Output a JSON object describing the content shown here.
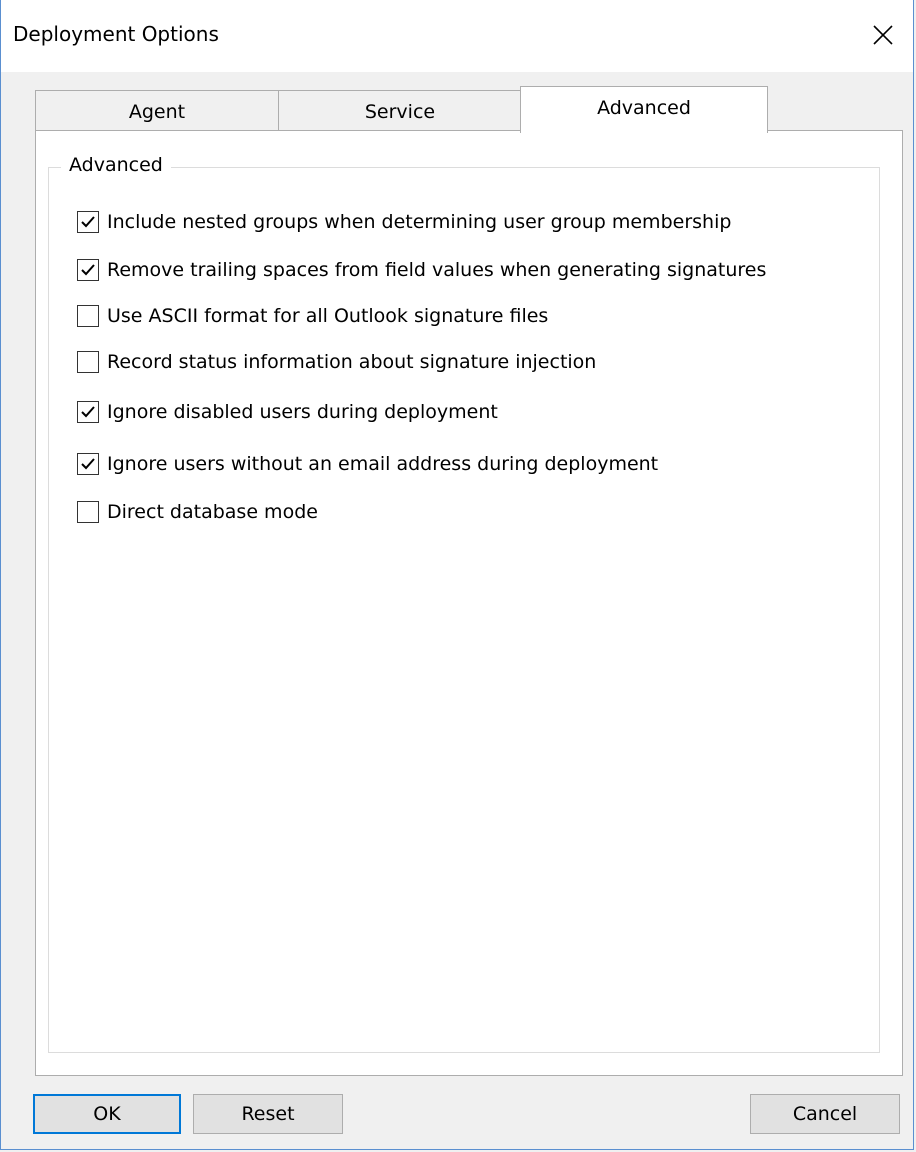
{
  "window": {
    "title": "Deployment Options",
    "close_glyph": "close-icon"
  },
  "tabs": [
    {
      "label": "Agent",
      "selected": false
    },
    {
      "label": "Service",
      "selected": false
    },
    {
      "label": "Advanced",
      "selected": true
    }
  ],
  "group": {
    "legend": "Advanced",
    "options": [
      {
        "label": "Include nested groups when determining user group membership",
        "checked": true
      },
      {
        "label": "Remove trailing spaces from field values when generating signatures",
        "checked": true
      },
      {
        "label": "Use ASCII format for all Outlook signature files",
        "checked": false
      },
      {
        "label": "Record status information about signature injection",
        "checked": false
      },
      {
        "label": "Ignore disabled users during deployment",
        "checked": true
      },
      {
        "label": "Ignore users without an email address during deployment",
        "checked": true
      },
      {
        "label": "Direct database mode",
        "checked": false
      }
    ]
  },
  "buttons": {
    "ok": "OK",
    "reset": "Reset",
    "cancel": "Cancel"
  },
  "colors": {
    "window_border": "#5a8fd0",
    "default_button_border": "#0078d7",
    "button_face": "#e1e1e1",
    "panel_background": "#ffffff",
    "dialog_background": "#f0f0f0"
  }
}
